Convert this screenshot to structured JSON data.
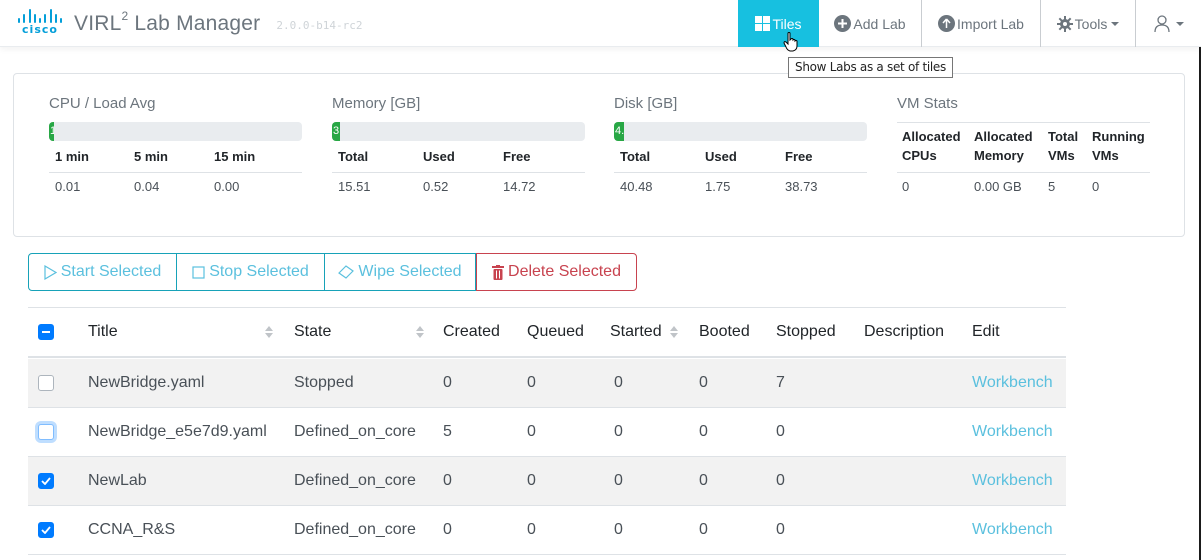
{
  "app": {
    "brand": "cisco",
    "title": "VIRL",
    "title_sup": "2",
    "title_rest": " Lab Manager",
    "version": "2.0.0-b14-rc2"
  },
  "nav": {
    "tiles": {
      "label": "Tiles",
      "icon": "grid-icon",
      "active": true
    },
    "add_lab": {
      "label": "Add Lab",
      "icon": "plus-circle-icon"
    },
    "import_lab": {
      "label": "Import Lab",
      "icon": "upload-circle-icon"
    },
    "tools": {
      "label": "Tools",
      "icon": "gear-icon"
    },
    "user": {
      "icon": "user-icon"
    }
  },
  "tooltip": "Show Labs as a set of tiles",
  "colors": {
    "accent": "#17c0e0",
    "link": "#5bc0de",
    "progress": "#28a745",
    "danger": "#c8434f",
    "checkbox": "#007bff"
  },
  "stats": {
    "cpu": {
      "title": "CPU / Load Avg",
      "progress_label": "1",
      "progress_percent": 1,
      "headers": [
        "1 min",
        "5 min",
        "15 min"
      ],
      "values": [
        "0.01",
        "0.04",
        "0.00"
      ]
    },
    "memory": {
      "title": "Memory [GB]",
      "progress_label": "3",
      "progress_percent": 3,
      "headers": [
        "Total",
        "Used",
        "Free"
      ],
      "values": [
        "15.51",
        "0.52",
        "14.72"
      ]
    },
    "disk": {
      "title": "Disk [GB]",
      "progress_label": "4.",
      "progress_percent": 4,
      "headers": [
        "Total",
        "Used",
        "Free"
      ],
      "values": [
        "40.48",
        "1.75",
        "38.73"
      ]
    },
    "vm": {
      "title": "VM Stats",
      "headers": [
        "Allocated CPUs",
        "Allocated Memory",
        "Total VMs",
        "Running VMs"
      ],
      "values": [
        "0",
        "0.00 GB",
        "5",
        "0"
      ]
    }
  },
  "actions": {
    "start": "Start Selected",
    "stop": "Stop Selected",
    "wipe": "Wipe Selected",
    "delete": "Delete Selected"
  },
  "table": {
    "select_all_state": "indeterminate",
    "columns": [
      "Title",
      "State",
      "Created",
      "Queued",
      "Started",
      "Booted",
      "Stopped",
      "Description",
      "Edit"
    ],
    "rows": [
      {
        "checked": false,
        "focused": false,
        "title": "NewBridge.yaml",
        "state": "Stopped",
        "created": "0",
        "queued": "0",
        "started": "0",
        "booted": "0",
        "stopped": "7",
        "description": "",
        "edit": "Workbench"
      },
      {
        "checked": false,
        "focused": true,
        "title": "NewBridge_e5e7d9.yaml",
        "state": "Defined_on_core",
        "created": "5",
        "queued": "0",
        "started": "0",
        "booted": "0",
        "stopped": "0",
        "description": "",
        "edit": "Workbench"
      },
      {
        "checked": true,
        "focused": false,
        "title": "NewLab",
        "state": "Defined_on_core",
        "created": "0",
        "queued": "0",
        "started": "0",
        "booted": "0",
        "stopped": "0",
        "description": "",
        "edit": "Workbench"
      },
      {
        "checked": true,
        "focused": false,
        "title": "CCNA_R&S",
        "state": "Defined_on_core",
        "created": "0",
        "queued": "0",
        "started": "0",
        "booted": "0",
        "stopped": "0",
        "description": "",
        "edit": "Workbench"
      }
    ]
  }
}
